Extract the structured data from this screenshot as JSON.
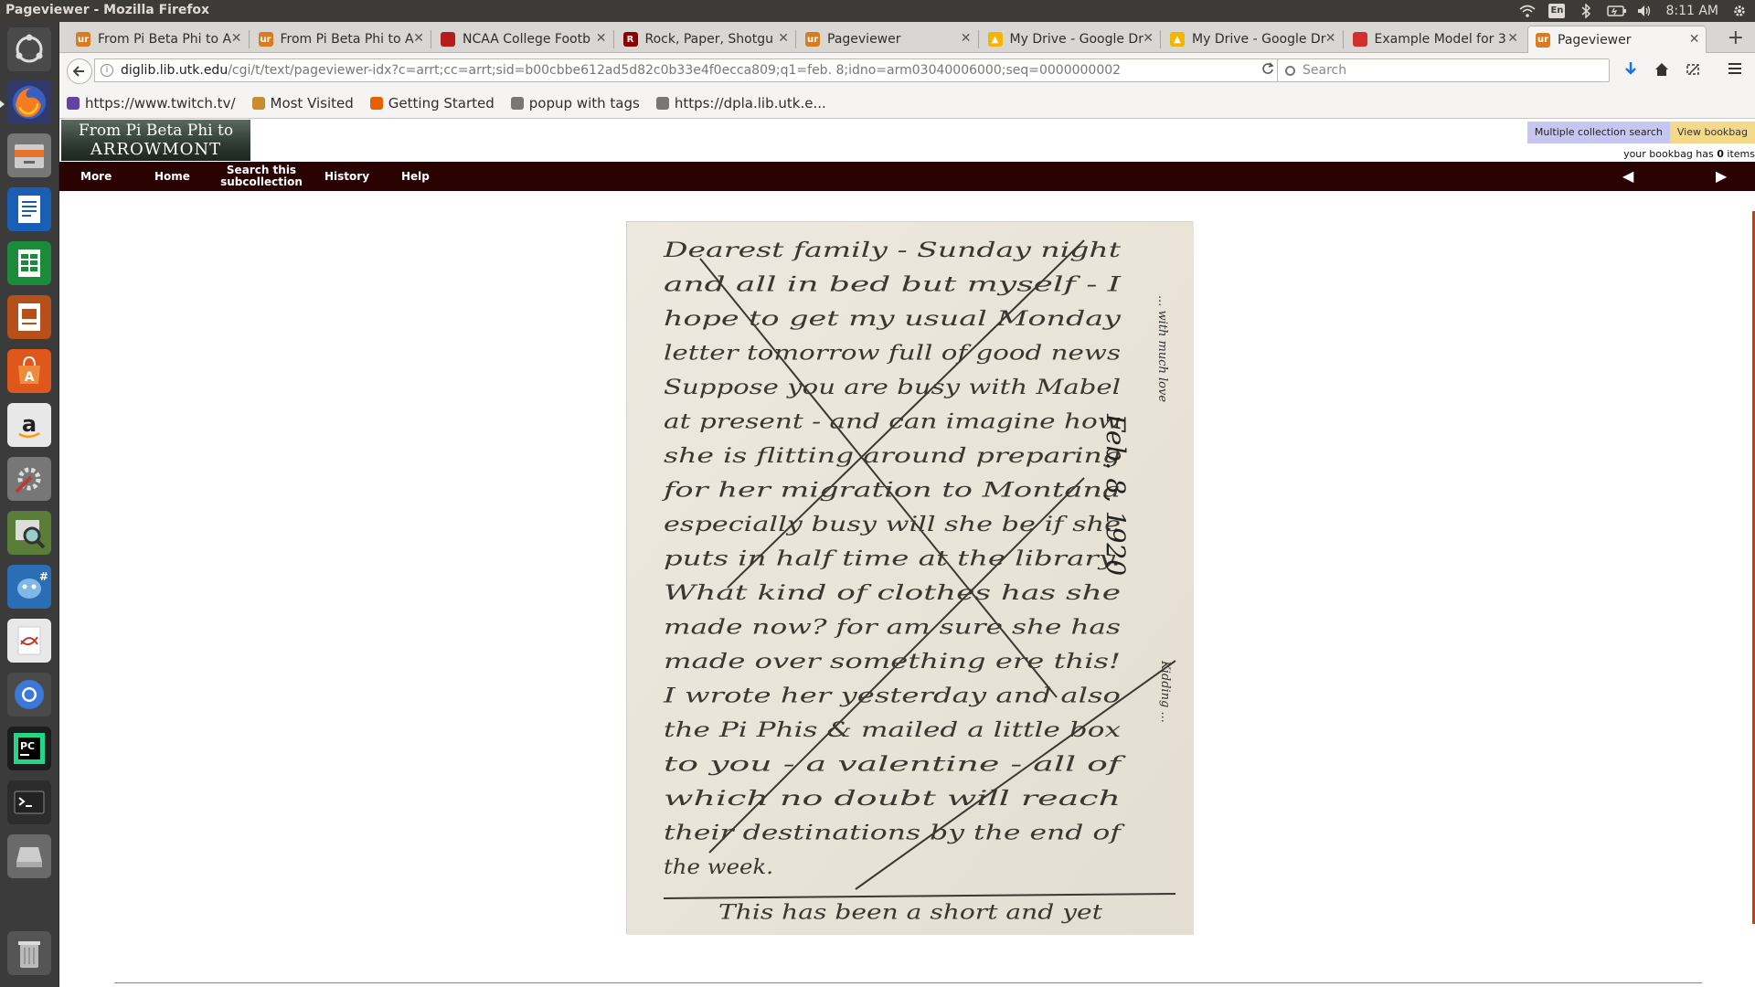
{
  "window": {
    "title": "Pageviewer - Mozilla Firefox"
  },
  "system": {
    "clock": "8:11 AM",
    "keyboard": "En",
    "icons": [
      "wifi-icon",
      "keyboard-icon",
      "bluetooth-icon",
      "battery-icon",
      "volume-icon",
      "settings-gear-icon"
    ]
  },
  "tabs": [
    {
      "label": "From Pi Beta Phi to A",
      "favicon_color": "#d97b1f",
      "favicon": "ur",
      "close": "✕"
    },
    {
      "label": "From Pi Beta Phi to A",
      "favicon_color": "#d97b1f",
      "favicon": "ur",
      "close": "✕"
    },
    {
      "label": "NCAA College Footb",
      "favicon_color": "#b71c1c",
      "favicon": "",
      "close": "✕"
    },
    {
      "label": "Rock, Paper, Shotgu",
      "favicon_color": "#8b0000",
      "favicon": "R",
      "close": "✕"
    },
    {
      "label": "Pageviewer",
      "favicon_color": "#d97b1f",
      "favicon": "ur",
      "close": "✕"
    },
    {
      "label": "My Drive - Google Dr",
      "favicon_color": "#f4b400",
      "favicon": "▲",
      "close": "✕"
    },
    {
      "label": "My Drive - Google Dr",
      "favicon_color": "#f4b400",
      "favicon": "▲",
      "close": "✕"
    },
    {
      "label": "Example Model for 3",
      "favicon_color": "#d32f2f",
      "favicon": "",
      "close": "✕"
    },
    {
      "label": "Pageviewer",
      "favicon_color": "#d97b1f",
      "favicon": "ur",
      "close": "✕",
      "active": true
    }
  ],
  "newtab_symbol": "+",
  "address": {
    "host": "diglib.lib.utk.edu",
    "path": "/cgi/t/text/pageviewer-idx?c=arrt;cc=arrt;sid=b00cbbe612ad5d82c0b33e4f0ecca809;q1=feb. 8;idno=arm03040006000;seq=0000000002"
  },
  "search": {
    "placeholder": "Search"
  },
  "bookmarks": [
    {
      "label": "https://www.twitch.tv/",
      "color": "#6441a5"
    },
    {
      "label": "Most Visited",
      "color": "#c98b2b"
    },
    {
      "label": "Getting Started",
      "color": "#e66000"
    },
    {
      "label": "popup with tags",
      "color": "#777777"
    },
    {
      "label": "https://dpla.lib.utk.e...",
      "color": "#777777"
    }
  ],
  "site": {
    "logo_line1": "From Pi Beta Phi to",
    "logo_line2": "ARROWMONT",
    "multi_search": "Multiple collection search",
    "view_bookbag": "View bookbag",
    "bookbag_prefix": "your bookbag has ",
    "bookbag_count": "0",
    "bookbag_suffix": " items",
    "nav": {
      "more": "More",
      "home": "Home",
      "search_sub": "Search this subcollection",
      "history": "History",
      "help": "Help"
    },
    "prev_arrow": "◀",
    "next_arrow": "▶"
  },
  "letter_text": [
    "Dearest family - Sunday night",
    "and all in bed but myself - I",
    "hope to get my usual Monday",
    "letter tomorrow full of good news",
    "Suppose you are busy with Mabel",
    "at present - and can imagine how",
    "she is flitting around preparing",
    "for her migration to Montana",
    "especially busy will she be if she",
    "puts in half time at the library.",
    "What kind of clothes has she",
    "made now? for am sure she has",
    "made over something ere this!",
    "I wrote her yesterday and also",
    "the Pi Phis & mailed a little box",
    "to you - a valentine - all of",
    "which no doubt will reach",
    "their destinations by the end of",
    "the week.",
    "This has been a short and yet"
  ],
  "letter_margin_right": "Feb. 8, 1920",
  "letter_margin_right2": "... with much love",
  "letter_margin_right3": "Kidding ..."
}
